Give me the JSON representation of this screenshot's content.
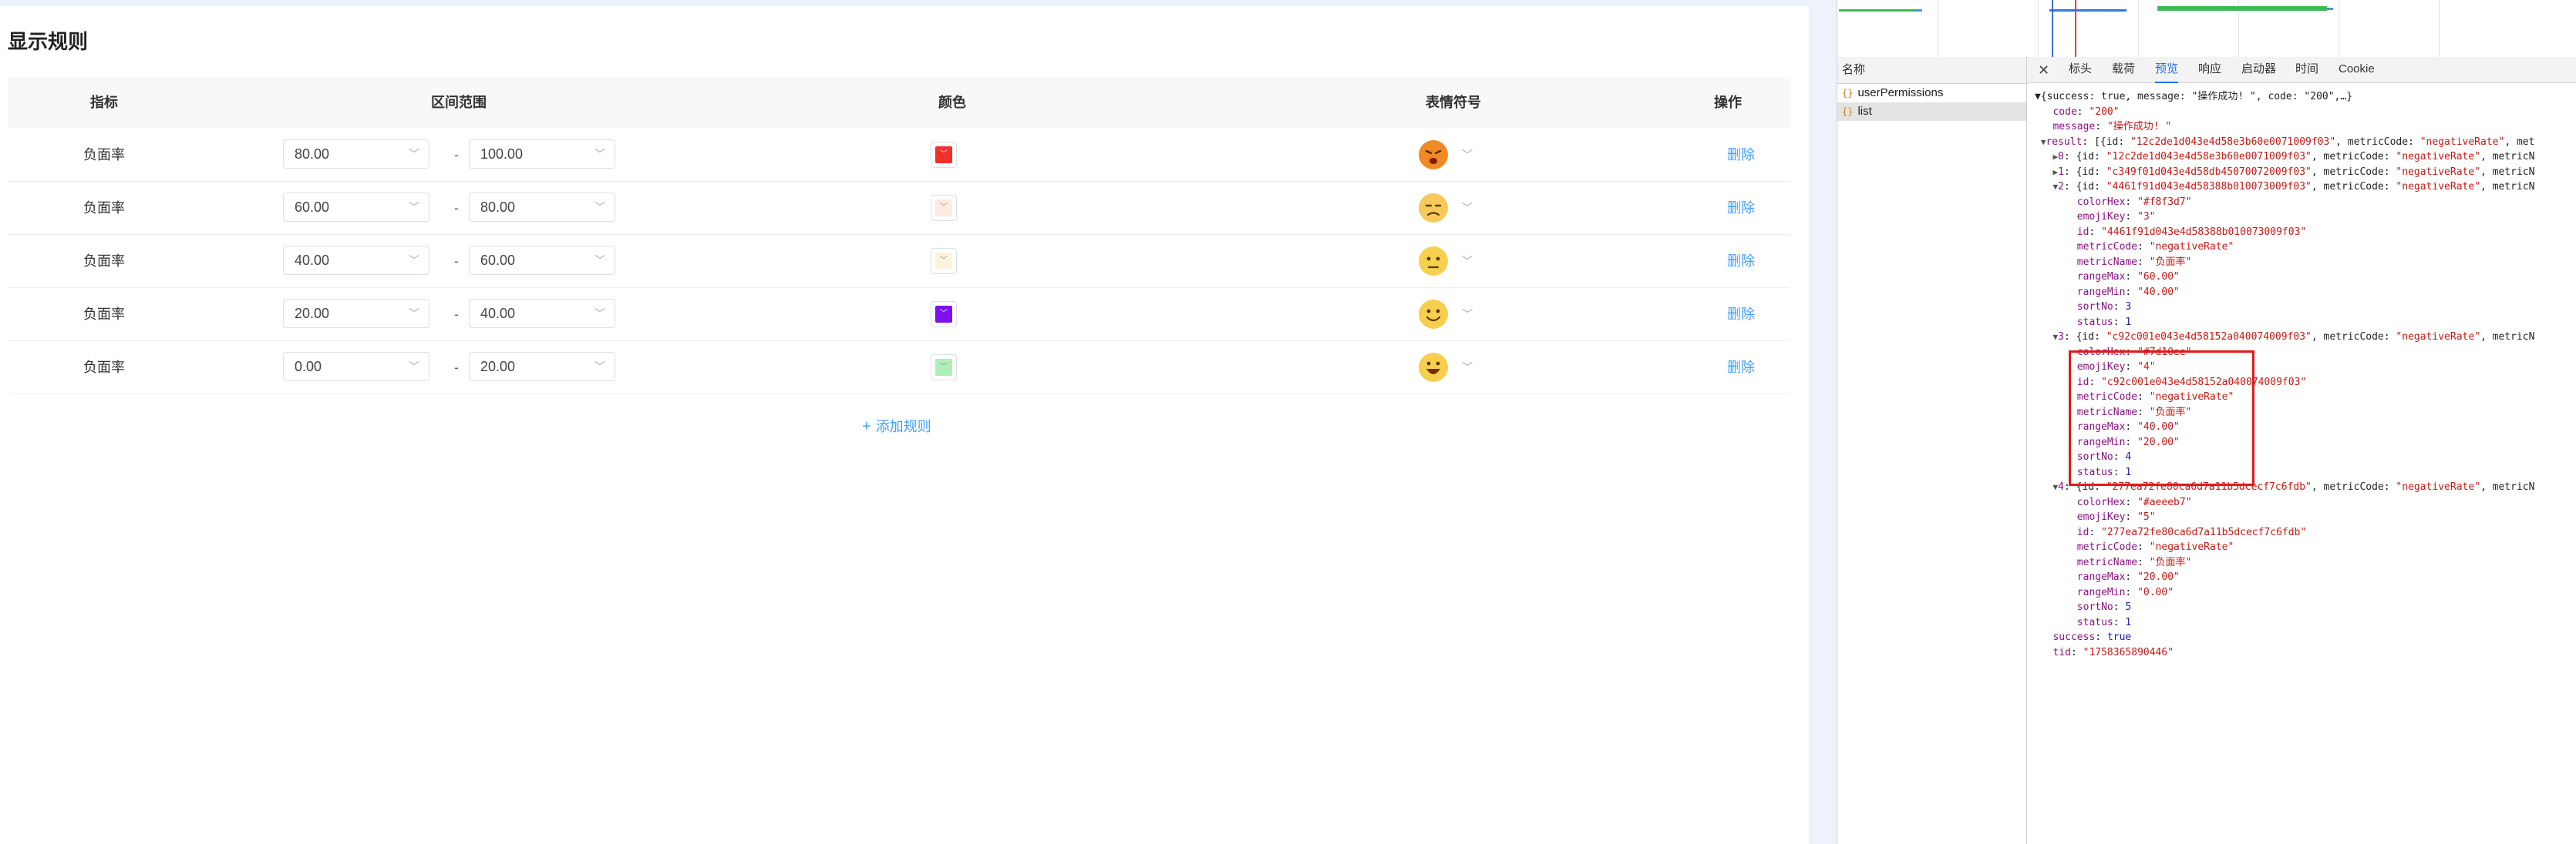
{
  "page": {
    "title": "显示规则"
  },
  "table": {
    "headers": {
      "metric": "指标",
      "range": "区间范围",
      "color": "颜色",
      "emoji": "表情符号",
      "action": "操作"
    },
    "separator": "-",
    "delete_label": "删除",
    "rows": [
      {
        "metric": "负面率",
        "min": "80.00",
        "max": "100.00",
        "color": "#f0302e",
        "emoji": "angry"
      },
      {
        "metric": "负面率",
        "min": "60.00",
        "max": "80.00",
        "color": "#fdebe0",
        "emoji": "sad"
      },
      {
        "metric": "负面率",
        "min": "40.00",
        "max": "60.00",
        "color": "#fdf3dd",
        "emoji": "neutral"
      },
      {
        "metric": "负面率",
        "min": "20.00",
        "max": "40.00",
        "color": "#7d10ee",
        "emoji": "smile"
      },
      {
        "metric": "负面率",
        "min": "0.00",
        "max": "20.00",
        "color": "#aeeeb7",
        "emoji": "grin"
      }
    ],
    "add_rule_label": "添加规则"
  },
  "devtools": {
    "name_header": "名称",
    "requests": [
      "userPermissions",
      "list"
    ],
    "selected_request": "list",
    "tabs": [
      "标头",
      "载荷",
      "预览",
      "响应",
      "启动器",
      "时间",
      "Cookie"
    ],
    "active_tab": "预览",
    "preview_lines": [
      "▼{success: true, message: \"操作成功! \", code: \"200\",…}",
      "   code: \"200\"",
      "   message: \"操作成功! \"",
      " ▼result: [{id: \"12c2de1d043e4d58e3b60e0071009f03\", metricCode: \"negativeRate\", met",
      "   ▶0: {id: \"12c2de1d043e4d58e3b60e0071009f03\", metricCode: \"negativeRate\", metricN",
      "   ▶1: {id: \"c349f01d043e4d58db45070072009f03\", metricCode: \"negativeRate\", metricN",
      "   ▼2: {id: \"4461f91d043e4d58388b010073009f03\", metricCode: \"negativeRate\", metricN",
      "       colorHex: \"#f8f3d7\"",
      "       emojiKey: \"3\"",
      "       id: \"4461f91d043e4d58388b010073009f03\"",
      "       metricCode: \"negativeRate\"",
      "       metricName: \"负面率\"",
      "       rangeMax: \"60.00\"",
      "       rangeMin: \"40.00\"",
      "       sortNo: 3",
      "       status: 1",
      "   ▼3: {id: \"c92c001e043e4d58152a040074009f03\", metricCode: \"negativeRate\", metricN",
      "       colorHex: \"#7d10ee\"",
      "       emojiKey: \"4\"",
      "       id: \"c92c001e043e4d58152a040074009f03\"",
      "       metricCode: \"negativeRate\"",
      "       metricName: \"负面率\"",
      "       rangeMax: \"40.00\"",
      "       rangeMin: \"20.00\"",
      "       sortNo: 4",
      "       status: 1",
      "   ▼4: {id: \"277ea72fe80ca6d7a11b5dcecf7c6fdb\", metricCode: \"negativeRate\", metricN",
      "       colorHex: \"#aeeeb7\"",
      "       emojiKey: \"5\"",
      "       id: \"277ea72fe80ca6d7a11b5dcecf7c6fdb\"",
      "       metricCode: \"negativeRate\"",
      "       metricName: \"负面率\"",
      "       rangeMax: \"20.00\"",
      "       rangeMin: \"0.00\"",
      "       sortNo: 5",
      "       status: 1",
      "   success: true",
      "   tid: \"1758365890446\""
    ]
  }
}
